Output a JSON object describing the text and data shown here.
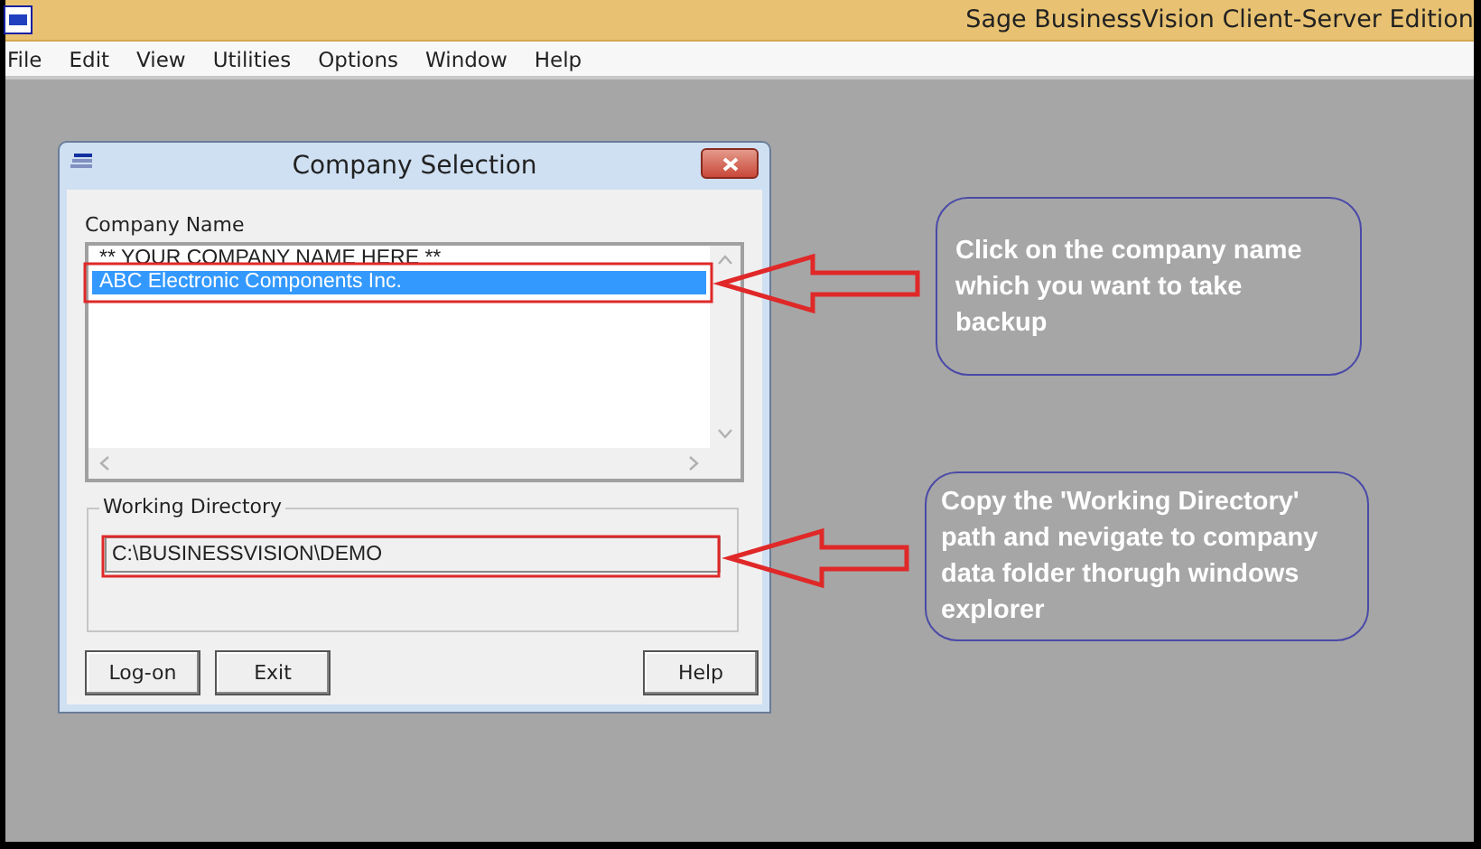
{
  "app": {
    "title": "Sage BusinessVision Client-Server Edition"
  },
  "menu": [
    "File",
    "Edit",
    "View",
    "Utilities",
    "Options",
    "Window",
    "Help"
  ],
  "dialog": {
    "title": "Company Selection",
    "company_list": {
      "label": "Company Name",
      "items": [
        {
          "name": "** YOUR COMPANY NAME HERE **",
          "selected": false
        },
        {
          "name": "ABC Electronic Components Inc.",
          "selected": true
        }
      ]
    },
    "working_directory": {
      "label": "Working Directory",
      "value": "C:\\BUSINESSVISION\\DEMO"
    },
    "buttons": [
      {
        "label": "Log-on",
        "kind": "left"
      },
      {
        "label": "Exit",
        "kind": "left"
      },
      {
        "label": "Help",
        "kind": "right"
      }
    ]
  },
  "annotations": [
    {
      "text": "Click on the company name which you want to take backup"
    },
    {
      "text": "Copy the 'Working Directory' path and nevigate to company data folder thorugh windows explorer"
    }
  ]
}
